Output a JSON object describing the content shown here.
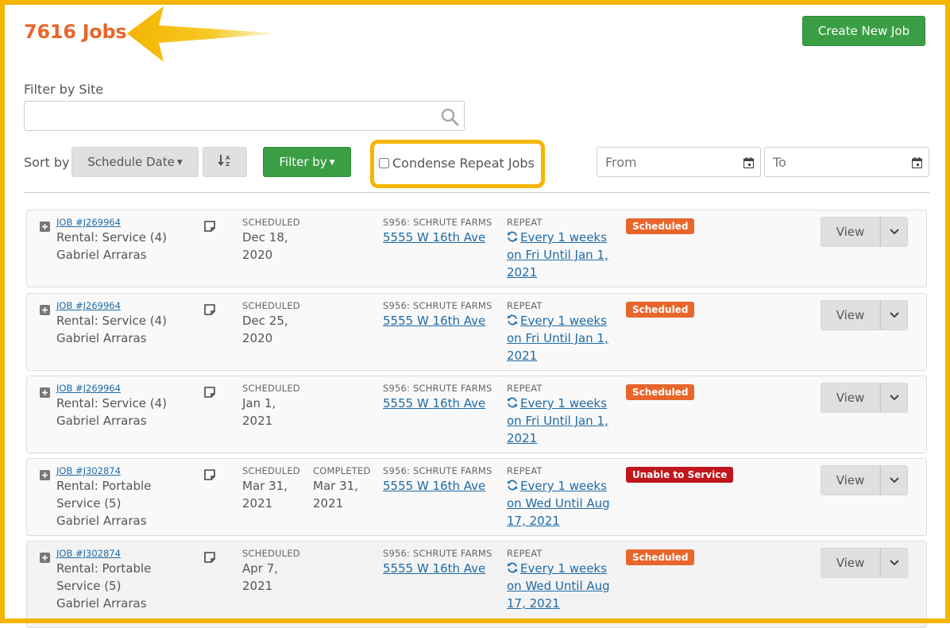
{
  "header": {
    "title": "7616 Jobs",
    "create_button": "Create New Job"
  },
  "filters": {
    "site_label": "Filter by Site",
    "site_value": "",
    "sort_label": "Sort by",
    "sort_value": "Schedule Date",
    "filter_button": "Filter by",
    "condense_label": "Condense Repeat Jobs",
    "condense_checked": false,
    "from_placeholder": "From",
    "to_placeholder": "To"
  },
  "labels": {
    "scheduled": "SCHEDULED",
    "completed": "COMPLETED",
    "repeat": "REPEAT",
    "view": "View"
  },
  "colors": {
    "accent_orange": "#e8662b",
    "highlight_yellow": "#f4b400",
    "primary_green": "#3a9e44",
    "link_blue": "#1f6aa5",
    "status_scheduled": "#e8662b",
    "status_unable": "#c0161c"
  },
  "jobs": [
    {
      "id": "JOB #J269964",
      "service": "Rental: Service (4)",
      "person": "Gabriel Arraras",
      "scheduled": "Dec 18, 2020",
      "completed": "",
      "site": "S956: SCHRUTE FARMS",
      "address": "5555 W 16th Ave",
      "repeat": "Every 1 weeks on Fri Until Jan 1, 2021",
      "status": "Scheduled",
      "status_color": "#e8662b"
    },
    {
      "id": "JOB #J269964",
      "service": "Rental: Service (4)",
      "person": "Gabriel Arraras",
      "scheduled": "Dec 25, 2020",
      "completed": "",
      "site": "S956: SCHRUTE FARMS",
      "address": "5555 W 16th Ave",
      "repeat": "Every 1 weeks on Fri Until Jan 1, 2021",
      "status": "Scheduled",
      "status_color": "#e8662b"
    },
    {
      "id": "JOB #J269964",
      "service": "Rental: Service (4)",
      "person": "Gabriel Arraras",
      "scheduled": "Jan 1, 2021",
      "completed": "",
      "site": "S956: SCHRUTE FARMS",
      "address": "5555 W 16th Ave",
      "repeat": "Every 1 weeks on Fri Until Jan 1, 2021",
      "status": "Scheduled",
      "status_color": "#e8662b"
    },
    {
      "id": "JOB #J302874",
      "service": "Rental: Portable Service (5)",
      "person": "Gabriel Arraras",
      "scheduled": "Mar 31, 2021",
      "completed": "Mar 31, 2021",
      "site": "S956: SCHRUTE FARMS",
      "address": "5555 W 16th Ave",
      "repeat": "Every 1 weeks on Wed Until Aug 17, 2021",
      "status": "Unable to Service",
      "status_color": "#c0161c"
    },
    {
      "id": "JOB #J302874",
      "service": "Rental: Portable Service (5)",
      "person": "Gabriel Arraras",
      "scheduled": "Apr 7, 2021",
      "completed": "",
      "site": "S956: SCHRUTE FARMS",
      "address": "5555 W 16th Ave",
      "repeat": "Every 1 weeks on Wed Until Aug 17, 2021",
      "status": "Scheduled",
      "status_color": "#e8662b"
    }
  ]
}
